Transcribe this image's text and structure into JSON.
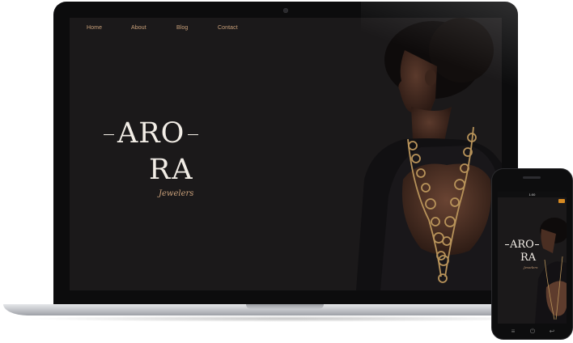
{
  "nav": {
    "items": [
      {
        "label": "Home"
      },
      {
        "label": "About"
      },
      {
        "label": "Blog"
      },
      {
        "label": "Contact"
      }
    ]
  },
  "hero": {
    "brand_line1": "ARO",
    "brand_line2": "RA",
    "tagline": "Jewelers"
  },
  "phone": {
    "status_time": "1:00",
    "menu_icon": "menu-icon",
    "buttons": [
      "menu-lines-icon",
      "power-icon",
      "back-icon"
    ]
  },
  "colors": {
    "background": "#1b191a",
    "accent": "#c9a07a",
    "text": "#f2ede6",
    "phone_menu": "#d78a22"
  }
}
